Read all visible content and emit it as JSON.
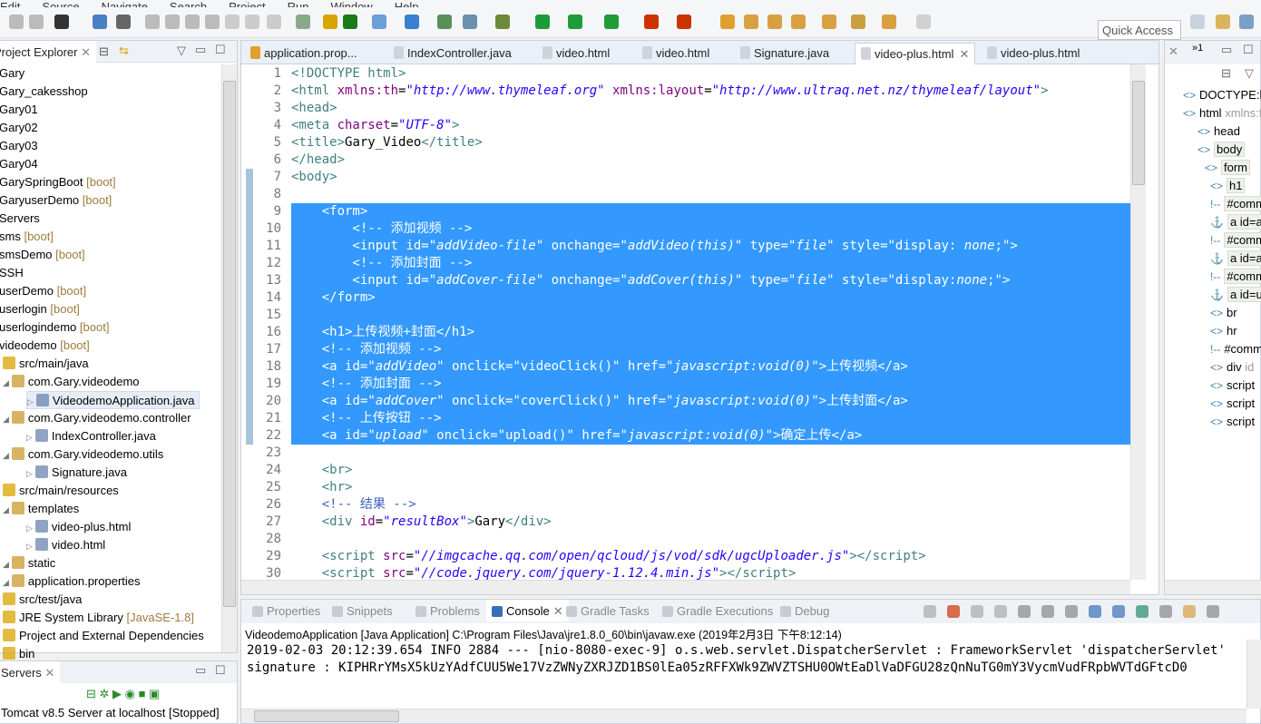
{
  "menu": [
    "Edit",
    "Source",
    "Navigate",
    "Search",
    "Project",
    "Run",
    "Window",
    "Help"
  ],
  "toolbar": {
    "quick_access": "Quick Access"
  },
  "explorer": {
    "title": "Project Explorer",
    "items": [
      {
        "label": "Gary",
        "lvl": 0
      },
      {
        "label": "Gary_cakesshop",
        "lvl": 0
      },
      {
        "label": "Gary01",
        "lvl": 0
      },
      {
        "label": "Gary02",
        "lvl": 0
      },
      {
        "label": "Gary03",
        "lvl": 0
      },
      {
        "label": "Gary04",
        "lvl": 0
      },
      {
        "label": "GarySpringBoot",
        "tag": "[boot]",
        "lvl": 0
      },
      {
        "label": "GaryuserDemo",
        "tag": "[boot]",
        "lvl": 0
      },
      {
        "label": "Servers",
        "lvl": 0
      },
      {
        "label": "sms",
        "tag": "[boot]",
        "lvl": 0
      },
      {
        "label": "smsDemo",
        "tag": "[boot]",
        "lvl": 0
      },
      {
        "label": "SSH",
        "lvl": 0
      },
      {
        "label": "userDemo",
        "tag": "[boot]",
        "lvl": 0
      },
      {
        "label": "userlogin",
        "tag": "[boot]",
        "lvl": 0
      },
      {
        "label": "userlogindemo",
        "tag": "[boot]",
        "lvl": 0
      },
      {
        "label": "videodemo",
        "tag": "[boot]",
        "lvl": 0
      },
      {
        "label": "src/main/java",
        "lvl": 1
      },
      {
        "label": "com.Gary.videodemo",
        "lvl": 2
      },
      {
        "label": "VideodemoApplication.java",
        "lvl": 3
      },
      {
        "label": "com.Gary.videodemo.controller",
        "lvl": 2
      },
      {
        "label": "IndexController.java",
        "lvl": 3
      },
      {
        "label": "com.Gary.videodemo.utils",
        "lvl": 2
      },
      {
        "label": "Signature.java",
        "lvl": 3
      },
      {
        "label": "src/main/resources",
        "lvl": 1
      },
      {
        "label": "templates",
        "lvl": 2
      },
      {
        "label": "video-plus.html",
        "lvl": 3
      },
      {
        "label": "video.html",
        "lvl": 3
      },
      {
        "label": "static",
        "lvl": 2
      },
      {
        "label": "application.properties",
        "lvl": 2
      },
      {
        "label": "src/test/java",
        "lvl": 1
      },
      {
        "label": "JRE System Library",
        "tag": "[JavaSE-1.8]",
        "lvl": 1
      },
      {
        "label": "Project and External Dependencies",
        "lvl": 1
      },
      {
        "label": "bin",
        "lvl": 1
      }
    ]
  },
  "servers": {
    "title": "Servers",
    "item": "Tomcat v8.5 Server at localhost  [Stopped]"
  },
  "editor": {
    "tabs": [
      "application.prop...",
      "IndexController.java",
      "video.html",
      "video.html",
      "Signature.java",
      "video-plus.html",
      "video-plus.html"
    ],
    "active_tab": 5,
    "lines": [
      [
        [
          "t-tag",
          "<!DOCTYPE html>"
        ]
      ],
      [
        [
          "t-tag",
          "<html "
        ],
        [
          "t-attr",
          "xmlns:th"
        ],
        [
          "t-txt",
          "="
        ],
        [
          "t-str",
          "\"http://www.thymeleaf.org\""
        ],
        [
          "t-attr",
          " xmlns:layout"
        ],
        [
          "t-txt",
          "="
        ],
        [
          "t-str",
          "\"http://www.ultraq.net.nz/thymeleaf/layout\""
        ],
        [
          "t-tag",
          ">"
        ]
      ],
      [
        [
          "t-tag",
          "<head>"
        ]
      ],
      [
        [
          "t-tag",
          "<meta "
        ],
        [
          "t-attr",
          "charset"
        ],
        [
          "t-txt",
          "="
        ],
        [
          "t-str",
          "\"UTF-8\""
        ],
        [
          "t-tag",
          ">"
        ]
      ],
      [
        [
          "t-tag",
          "<title>"
        ],
        [
          "t-txt",
          "Gary_Video"
        ],
        [
          "t-tag",
          "</title>"
        ]
      ],
      [
        [
          "t-tag",
          "</head>"
        ]
      ],
      [
        [
          "t-tag",
          "<body>"
        ]
      ],
      [],
      [
        [
          "t-tag",
          "    <form>"
        ]
      ],
      [
        [
          "t-cmt",
          "        <!-- 添加视频 -->"
        ]
      ],
      [
        [
          "t-tag",
          "        <input "
        ],
        [
          "t-attr",
          "id"
        ],
        [
          "t-txt",
          "="
        ],
        [
          "t-str",
          "\"addVideo-file\""
        ],
        [
          "t-attr",
          " onchange"
        ],
        [
          "t-txt",
          "="
        ],
        [
          "t-str",
          "\"addVideo(this)\""
        ],
        [
          "t-attr",
          " type"
        ],
        [
          "t-txt",
          "="
        ],
        [
          "t-str",
          "\"file\""
        ],
        [
          "t-attr",
          " style"
        ],
        [
          "t-txt",
          "=\"display: "
        ],
        [
          "t-str",
          "none"
        ],
        [
          "t-txt",
          ";\""
        ],
        [
          "t-tag",
          ">"
        ]
      ],
      [
        [
          "t-cmt",
          "        <!-- 添加封面 -->"
        ]
      ],
      [
        [
          "t-tag",
          "        <input "
        ],
        [
          "t-attr",
          "id"
        ],
        [
          "t-txt",
          "="
        ],
        [
          "t-str",
          "\"addCover-file\""
        ],
        [
          "t-attr",
          " onchange"
        ],
        [
          "t-txt",
          "="
        ],
        [
          "t-str",
          "\"addCover(this)\""
        ],
        [
          "t-attr",
          " type"
        ],
        [
          "t-txt",
          "="
        ],
        [
          "t-str",
          "\"file\""
        ],
        [
          "t-attr",
          " style"
        ],
        [
          "t-txt",
          "=\"display:"
        ],
        [
          "t-str",
          "none"
        ],
        [
          "t-txt",
          ";\""
        ],
        [
          "t-tag",
          ">"
        ]
      ],
      [
        [
          "t-tag",
          "    </form>"
        ]
      ],
      [],
      [
        [
          "t-tag",
          "    <h1>"
        ],
        [
          "t-txt",
          "上传视频+封面"
        ],
        [
          "t-tag",
          "</h1>"
        ]
      ],
      [
        [
          "t-cmt",
          "    <!-- 添加视频 -->"
        ]
      ],
      [
        [
          "t-tag",
          "    <a "
        ],
        [
          "t-attr",
          "id"
        ],
        [
          "t-txt",
          "="
        ],
        [
          "t-str",
          "\"addVideo\""
        ],
        [
          "t-attr",
          " onclick"
        ],
        [
          "t-txt",
          "=\"videoClick()\""
        ],
        [
          "t-attr",
          " href"
        ],
        [
          "t-txt",
          "="
        ],
        [
          "t-str",
          "\"javascript:void(0)\""
        ],
        [
          "t-tag",
          ">"
        ],
        [
          "t-txt",
          "上传视频"
        ],
        [
          "t-tag",
          "</a>"
        ]
      ],
      [
        [
          "t-cmt",
          "    <!-- 添加封面 -->"
        ]
      ],
      [
        [
          "t-tag",
          "    <a "
        ],
        [
          "t-attr",
          "id"
        ],
        [
          "t-txt",
          "="
        ],
        [
          "t-str",
          "\"addCover\""
        ],
        [
          "t-attr",
          " onclick"
        ],
        [
          "t-txt",
          "=\"coverClick()\""
        ],
        [
          "t-attr",
          " href"
        ],
        [
          "t-txt",
          "="
        ],
        [
          "t-str",
          "\"javascript:void(0)\""
        ],
        [
          "t-tag",
          ">"
        ],
        [
          "t-txt",
          "上传封面"
        ],
        [
          "t-tag",
          "</a>"
        ]
      ],
      [
        [
          "t-cmt",
          "    <!-- 上传按钮 -->"
        ]
      ],
      [
        [
          "t-tag",
          "    <a "
        ],
        [
          "t-attr",
          "id"
        ],
        [
          "t-txt",
          "="
        ],
        [
          "t-str",
          "\"upload\""
        ],
        [
          "t-attr",
          " onclick"
        ],
        [
          "t-txt",
          "=\"upload()\""
        ],
        [
          "t-attr",
          " href"
        ],
        [
          "t-txt",
          "="
        ],
        [
          "t-str",
          "\"javascript:void(0)\""
        ],
        [
          "t-tag",
          ">"
        ],
        [
          "t-txt",
          "确定上传"
        ],
        [
          "t-tag",
          "</a>"
        ]
      ],
      [],
      [
        [
          "t-tag",
          "    <br>"
        ]
      ],
      [
        [
          "t-tag",
          "    <hr>"
        ]
      ],
      [
        [
          "t-cmt",
          "    <!-- 结果 -->"
        ]
      ],
      [
        [
          "t-tag",
          "    <div "
        ],
        [
          "t-attr",
          "id"
        ],
        [
          "t-txt",
          "="
        ],
        [
          "t-str",
          "\"resultBox\""
        ],
        [
          "t-tag",
          ">"
        ],
        [
          "t-txt",
          "Gary"
        ],
        [
          "t-tag",
          "</div>"
        ]
      ],
      [],
      [
        [
          "t-tag",
          "    <script "
        ],
        [
          "t-attr",
          "src"
        ],
        [
          "t-txt",
          "="
        ],
        [
          "t-str",
          "\"//imgcache.qq.com/open/qcloud/js/vod/sdk/ugcUploader.js\""
        ],
        [
          "t-tag",
          "></script>"
        ]
      ],
      [
        [
          "t-tag",
          "    <script "
        ],
        [
          "t-attr",
          "src"
        ],
        [
          "t-txt",
          "="
        ],
        [
          "t-str",
          "\"//code.jquery.com/jquery-1.12.4.min.js\""
        ],
        [
          "t-tag",
          "></script>"
        ]
      ]
    ],
    "selection": {
      "from_line": 9,
      "to_line": 22
    }
  },
  "outline": {
    "items": [
      {
        "label": "DOCTYPE:html",
        "lvl": 0
      },
      {
        "label": "html",
        "extra": "xmlns:th",
        "lvl": 0
      },
      {
        "label": "head",
        "lvl": 1
      },
      {
        "label": "body",
        "lvl": 1
      },
      {
        "label": "form",
        "lvl": 2
      },
      {
        "label": "h1",
        "lvl": 2
      },
      {
        "label": "#comment",
        "lvl": 2
      },
      {
        "label": "a id=addVideo",
        "lvl": 2
      },
      {
        "label": "#comment",
        "lvl": 2
      },
      {
        "label": "a id=addCover",
        "lvl": 2
      },
      {
        "label": "#comment",
        "lvl": 2
      },
      {
        "label": "a id=upload",
        "lvl": 2
      },
      {
        "label": "br",
        "lvl": 2
      },
      {
        "label": "hr",
        "lvl": 2
      },
      {
        "label": "#comment",
        "lvl": 2
      },
      {
        "label": "div",
        "extra": "id",
        "lvl": 2
      },
      {
        "label": "script",
        "lvl": 2
      },
      {
        "label": "script",
        "lvl": 2
      },
      {
        "label": "script",
        "lvl": 2
      }
    ]
  },
  "console": {
    "tabs": [
      "Properties",
      "Snippets",
      "Problems",
      "Console",
      "Gradle Tasks",
      "Gradle Executions",
      "Debug"
    ],
    "active_tab": 3,
    "process": "VideodemoApplication [Java Application] C:\\Program Files\\Java\\jre1.8.0_60\\bin\\javaw.exe (2019年2月3日 下午8:12:14)",
    "lines": [
      "2019-02-03 20:12:39.654  INFO 2884 --- [nio-8080-exec-9] o.s.web.servlet.DispatcherServlet        : FrameworkServlet 'dispatcherServlet'",
      "signature : KIPHRrYMsX5kUzYAdfCUU5We17VzZWNyZXRJZD1BS0lEa05zRFFXWk9ZWVZTSHU0OWtEaDlVaDFGU28zQnNuTG0mY3VycmVudFRpbWVTdGFtcD0"
    ]
  }
}
